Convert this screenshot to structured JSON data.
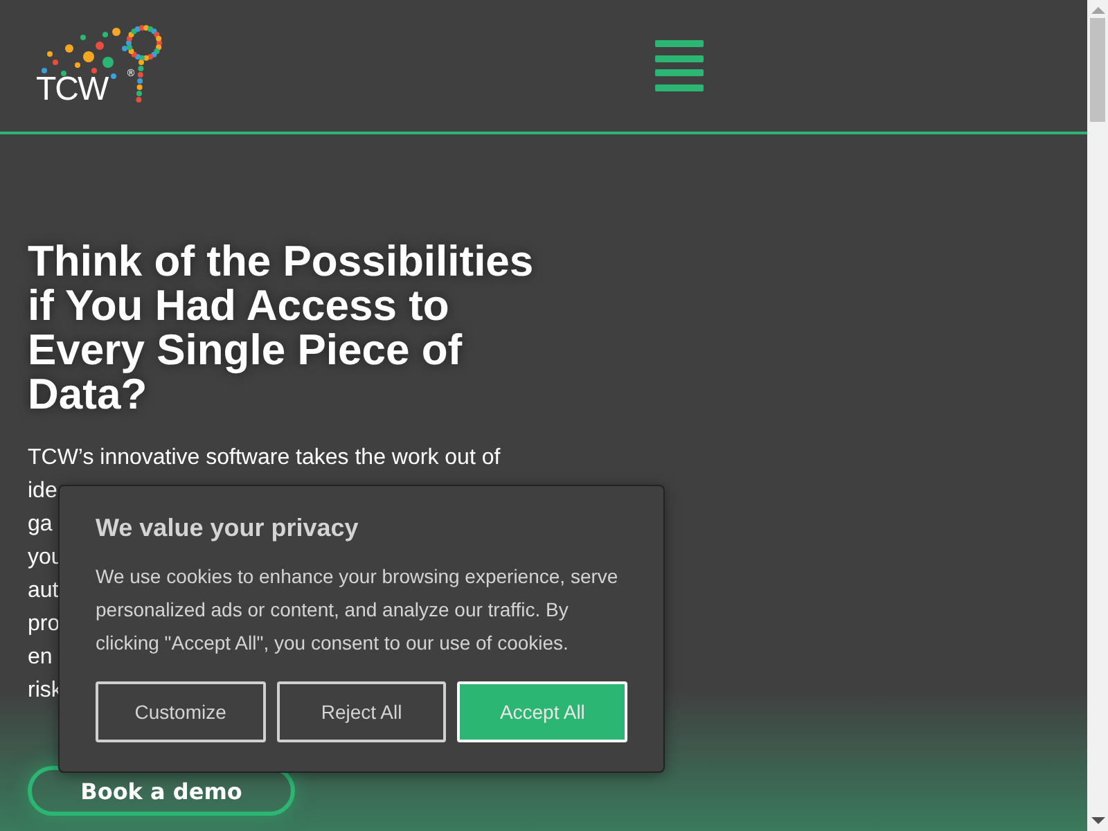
{
  "header": {
    "logo_text": "TCW",
    "logo_mark": "®"
  },
  "hero": {
    "heading": "Think of the Possibilities if You Had Access to Every Single Piece of Data?",
    "paragraph_lines": [
      "TCW’s innovative software takes the work out of",
      "ide",
      "ga",
      "you",
      "aut",
      "pro",
      "en",
      "risk"
    ],
    "cta": "Book a demo"
  },
  "cookie_banner": {
    "title": "We value your privacy",
    "text": "We use cookies to enhance your browsing experience, serve personalized ads or content, and analyze our traffic. By clicking \"Accept All\", you consent to our use of cookies.",
    "buttons": [
      {
        "label": "Customize",
        "kind": "outline"
      },
      {
        "label": "Reject All",
        "kind": "outline"
      },
      {
        "label": "Accept All",
        "kind": "primary"
      }
    ]
  }
}
